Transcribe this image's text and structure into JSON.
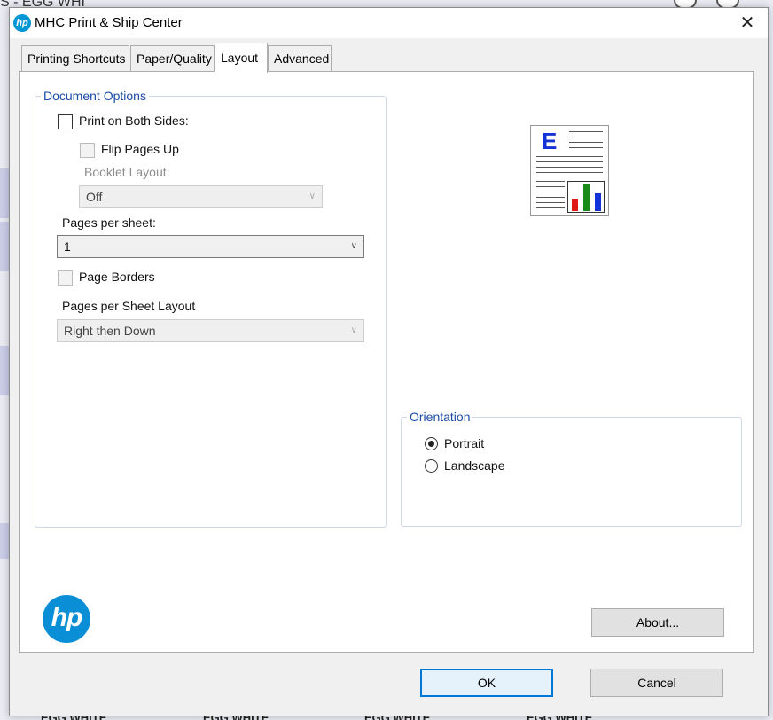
{
  "background": {
    "title_fragment": "S - EGG WHI",
    "bottom_items": [
      "EGG WHITE",
      "EGG WHITE",
      "EGG WHITE",
      "EGG WHITE"
    ]
  },
  "dialog": {
    "title": "MHC Print & Ship Center",
    "close_glyph": "✕",
    "app_icon_text": "hp"
  },
  "tabs": [
    {
      "label": "Printing Shortcuts",
      "active": false
    },
    {
      "label": "Paper/Quality",
      "active": false
    },
    {
      "label": "Layout",
      "active": true
    },
    {
      "label": "Advanced",
      "active": false
    }
  ],
  "document_options": {
    "legend": "Document Options",
    "print_both_sides": {
      "label": "Print on Both Sides:",
      "checked": false
    },
    "flip_pages_up": {
      "label": "Flip Pages Up",
      "checked": false,
      "enabled": false
    },
    "booklet_layout": {
      "label": "Booklet Layout:",
      "value": "Off",
      "enabled": false
    },
    "pages_per_sheet": {
      "label": "Pages per sheet:",
      "value": "1"
    },
    "page_borders": {
      "label": "Page Borders",
      "checked": false,
      "enabled": false
    },
    "pages_per_sheet_layout": {
      "label": "Pages per Sheet Layout",
      "value": "Right then Down",
      "enabled": false
    }
  },
  "orientation": {
    "legend": "Orientation",
    "options": [
      {
        "label": "Portrait",
        "selected": true
      },
      {
        "label": "Landscape",
        "selected": false
      }
    ]
  },
  "buttons": {
    "about": "About...",
    "ok": "OK",
    "cancel": "Cancel"
  },
  "logo": {
    "text": "hp"
  },
  "colors": {
    "accent": "#0078d7",
    "legend_text": "#1a4ca8",
    "hp_blue": "#0a8fd6",
    "preview_e": "#1433d6",
    "preview_bars": [
      "#e01919",
      "#1a8a1a",
      "#1433d6"
    ]
  }
}
